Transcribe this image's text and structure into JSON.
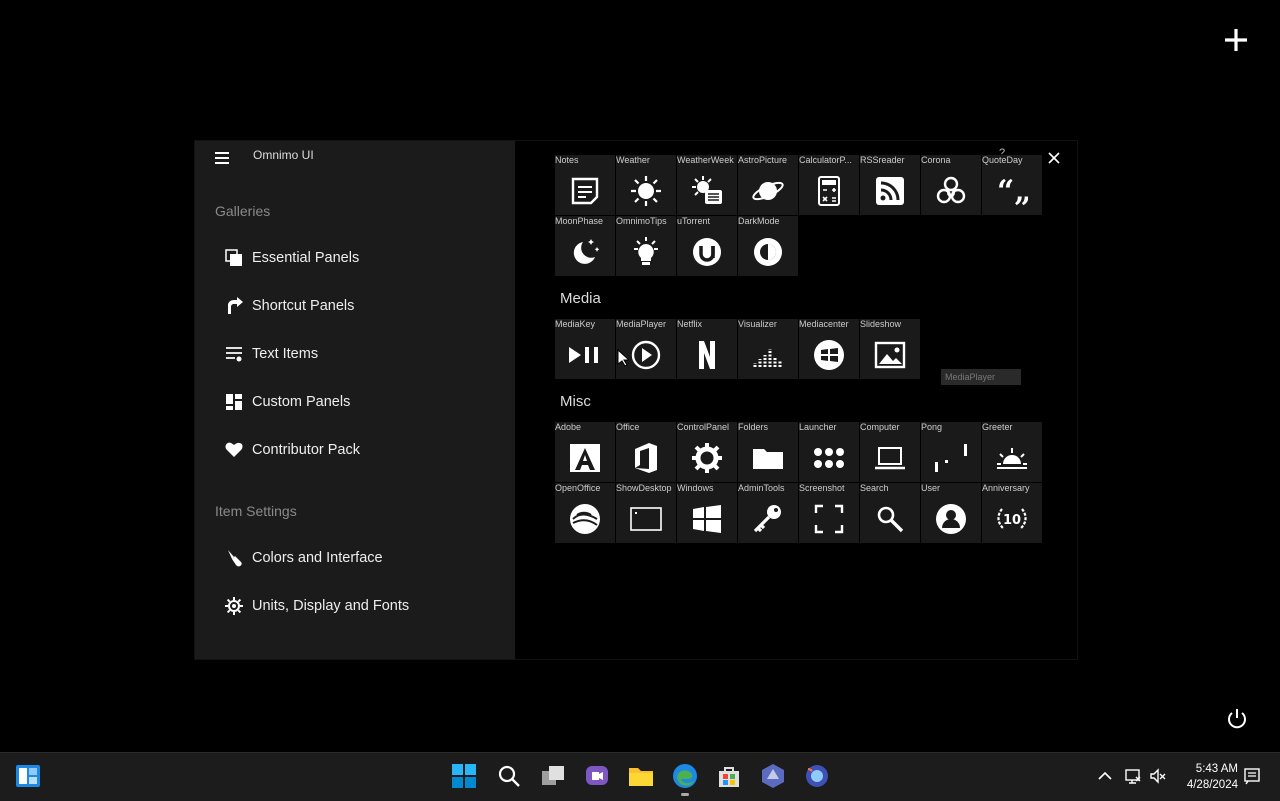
{
  "app": {
    "title": "Omnimo UI"
  },
  "sidebar": {
    "sections": [
      "Galleries",
      "Item Settings"
    ],
    "items": [
      {
        "label": "Essential Panels"
      },
      {
        "label": "Shortcut Panels"
      },
      {
        "label": "Text Items"
      },
      {
        "label": "Custom Panels"
      },
      {
        "label": "Contributor Pack"
      },
      {
        "label": "Colors and Interface"
      },
      {
        "label": "Units, Display and Fonts"
      }
    ]
  },
  "content": {
    "help": "?",
    "groups": [
      "Media",
      "Misc"
    ],
    "tiles": [
      "Notes",
      "Weather",
      "WeatherWeek",
      "AstroPicture",
      "CalculatorP...",
      "RSSreader",
      "Corona",
      "QuoteDay",
      "MoonPhase",
      "OmnimoTips",
      "uTorrent",
      "DarkMode",
      "MediaKey",
      "MediaPlayer",
      "Netflix",
      "Visualizer",
      "Mediacenter",
      "Slideshow",
      "Adobe",
      "Office",
      "ControlPanel",
      "Folders",
      "Launcher",
      "Computer",
      "Pong",
      "Greeter",
      "OpenOffice",
      "ShowDesktop",
      "Windows",
      "AdminTools",
      "Screenshot",
      "Search",
      "User",
      "Anniversary"
    ],
    "anniversary_number": "10",
    "tooltip": "MediaPlayer"
  },
  "taskbar": {
    "time": "5:43 AM",
    "date": "4/28/2024"
  },
  "colors": {
    "accent": "#0078d4",
    "sidebar_bg": "#1b1b1b",
    "tile_bg": "#1a1a1a"
  }
}
